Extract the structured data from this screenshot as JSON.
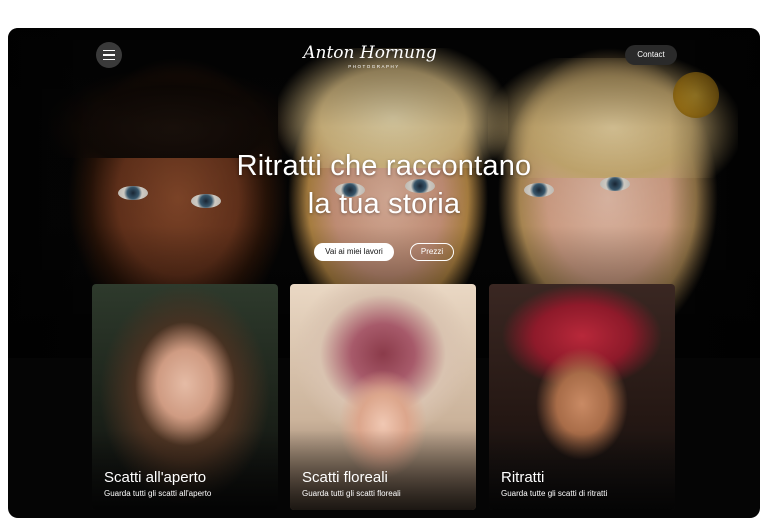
{
  "header": {
    "menu_icon": "hamburger-icon",
    "logo_script": "Anton Hornung",
    "logo_tagline": "PHOTOGRAPHY",
    "contact_label": "Contact"
  },
  "hero": {
    "headline_line1": "Ritratti che raccontano",
    "headline_line2": "la tua storia",
    "primary_cta": "Vai ai miei lavori",
    "secondary_cta": "Prezzi"
  },
  "cards": [
    {
      "title": "Scatti all'aperto",
      "subtitle": "Guarda tutti gli scatti all'aperto"
    },
    {
      "title": "Scatti floreali",
      "subtitle": "Guarda tutti gli scatti floreali"
    },
    {
      "title": "Ritratti",
      "subtitle": "Guarda tutte gli scatti di ritratti"
    }
  ],
  "colors": {
    "background": "#050505",
    "button_light": "#ffffff",
    "button_dark": "#2a2a2a",
    "text": "#ffffff"
  }
}
